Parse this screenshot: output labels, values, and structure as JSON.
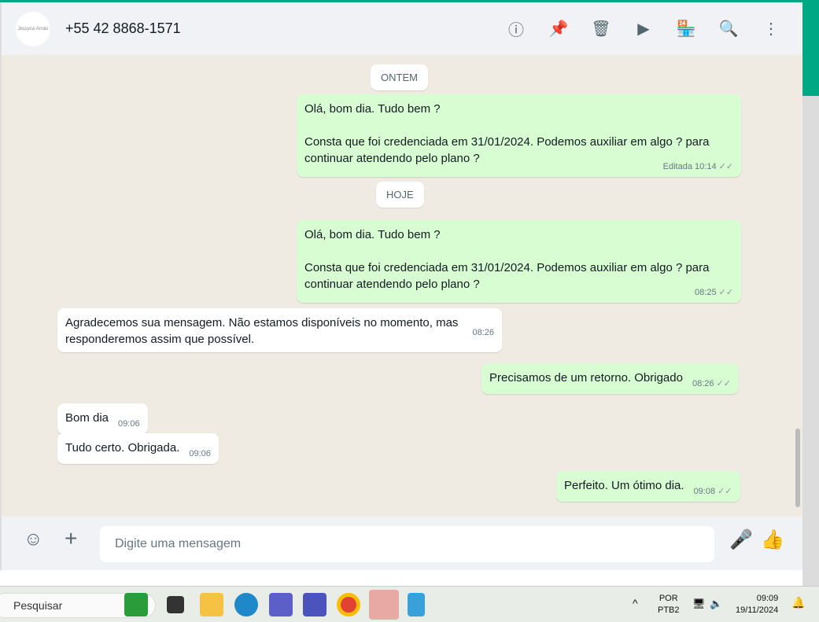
{
  "header": {
    "contact": "+55 42 8868-1571",
    "avatar_text": "Jessyca Arrais"
  },
  "header_icons": [
    "info-icon",
    "pin-icon",
    "trash-icon",
    "label-icon",
    "store-icon",
    "search-icon",
    "menu-icon"
  ],
  "chat": {
    "date1": "ONTEM",
    "date2": "HOJE",
    "messages": [
      {
        "dir": "out",
        "lines": [
          "Olá, bom dia. Tudo bem ?",
          "",
          "Consta que foi credenciada em 31/01/2024. Podemos auxiliar em algo ? para continuar atendendo pelo plano ?"
        ],
        "edited": "Editada",
        "time": "10:14"
      },
      {
        "dir": "out",
        "lines": [
          "Olá, bom dia. Tudo bem ?",
          "",
          "Consta que foi credenciada em 31/01/2024. Podemos auxiliar em algo ? para continuar atendendo pelo plano ?"
        ],
        "time": "08:25"
      },
      {
        "dir": "in",
        "text": "Agradecemos sua mensagem. Não estamos disponíveis no momento, mas respondere­mos assim que possível.",
        "time": "08:26"
      },
      {
        "dir": "out",
        "text": "Precisamos de um retorno. Obrigado",
        "time": "08:26"
      },
      {
        "dir": "in",
        "text": "Bom dia",
        "time": "09:06"
      },
      {
        "dir": "in",
        "text": "Tudo certo. Obrigada.",
        "time": "09:06"
      },
      {
        "dir": "out",
        "text": "Perfeito. Um ótimo dia.",
        "time": "09:08"
      }
    ]
  },
  "composer": {
    "placeholder": "Digite uma mensagem"
  },
  "taskbar": {
    "search": "Pesquisar",
    "lang1": "POR",
    "lang2": "PTB2",
    "time": "09:09",
    "date": "19/11/2024"
  }
}
